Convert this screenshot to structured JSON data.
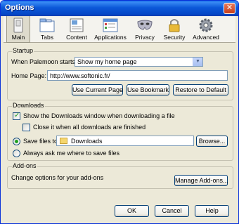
{
  "window": {
    "title": "Options",
    "close_glyph": "✕"
  },
  "tabs": [
    {
      "label": "Main",
      "icon": "switch-icon"
    },
    {
      "label": "Tabs",
      "icon": "tabs-icon"
    },
    {
      "label": "Content",
      "icon": "content-icon"
    },
    {
      "label": "Applications",
      "icon": "applications-icon"
    },
    {
      "label": "Privacy",
      "icon": "privacy-mask-icon"
    },
    {
      "label": "Security",
      "icon": "padlock-icon"
    },
    {
      "label": "Advanced",
      "icon": "gear-icon"
    }
  ],
  "startup": {
    "group_title": "Startup",
    "when_starts_label": "When Palemoon starts:",
    "when_starts_value": "Show my home page",
    "home_page_label": "Home Page:",
    "home_page_value": "http://www.softonic.fr/",
    "use_current_page": "Use Current Page",
    "use_bookmark": "Use Bookmark",
    "restore_default": "Restore to Default"
  },
  "downloads": {
    "group_title": "Downloads",
    "show_window_label": "Show the Downloads window when downloading a file",
    "show_window_checked": true,
    "close_it_label": "Close it when all downloads are finished",
    "close_it_checked": false,
    "save_files_label": "Save files to",
    "save_folder": "Downloads",
    "browse": "Browse...",
    "always_ask_label": "Always ask me where to save files",
    "selected": "save_files"
  },
  "addons": {
    "group_title": "Add-ons",
    "description": "Change options for your add-ons",
    "manage": "Manage Add-ons..."
  },
  "footer": {
    "ok": "OK",
    "cancel": "Cancel",
    "help": "Help"
  },
  "colors": {
    "title_bar": "#0c58d8",
    "dialog_bg": "#ece9d8",
    "check": "#21a121"
  }
}
